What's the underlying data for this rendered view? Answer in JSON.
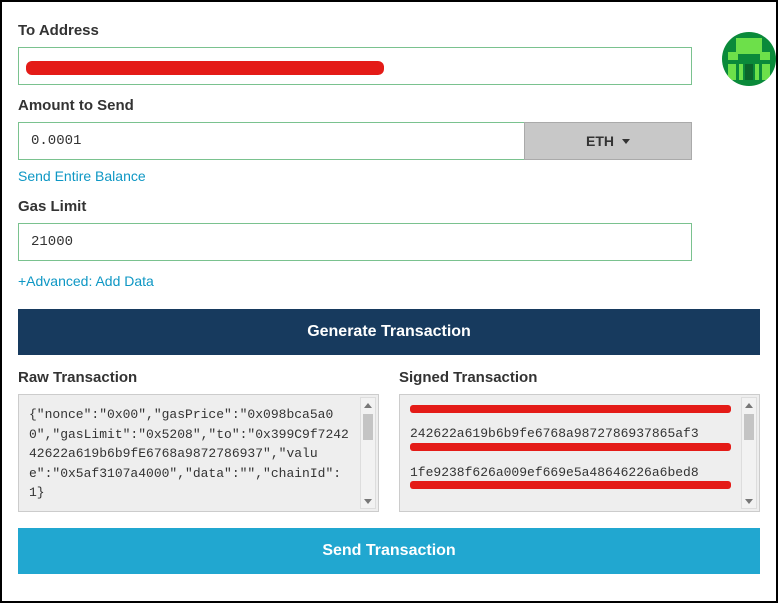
{
  "labels": {
    "to_address": "To Address",
    "amount": "Amount to Send",
    "gas_limit": "Gas Limit",
    "raw_tx": "Raw Transaction",
    "signed_tx": "Signed Transaction"
  },
  "form": {
    "to_address_value": "",
    "amount_value": "0.0001",
    "currency": "ETH",
    "gas_limit_value": "21000"
  },
  "links": {
    "send_entire_balance": "Send Entire Balance",
    "advanced": "+Advanced: Add Data"
  },
  "buttons": {
    "generate": "Generate Transaction",
    "send": "Send Transaction"
  },
  "tx": {
    "raw": "{\"nonce\":\"0x00\",\"gasPrice\":\"0x098bca5a00\",\"gasLimit\":\"0x5208\",\"to\":\"0x399C9f724242622a619b6b9fE6768a9872786937\",\"value\":\"0x5af3107a4000\",\"data\":\"\",\"chainId\":1}",
    "signed": "242622a619b6b9fe6768a98727869378​65af3\n1fe9238f626a009ef669e5a48646226a​6bed8"
  }
}
